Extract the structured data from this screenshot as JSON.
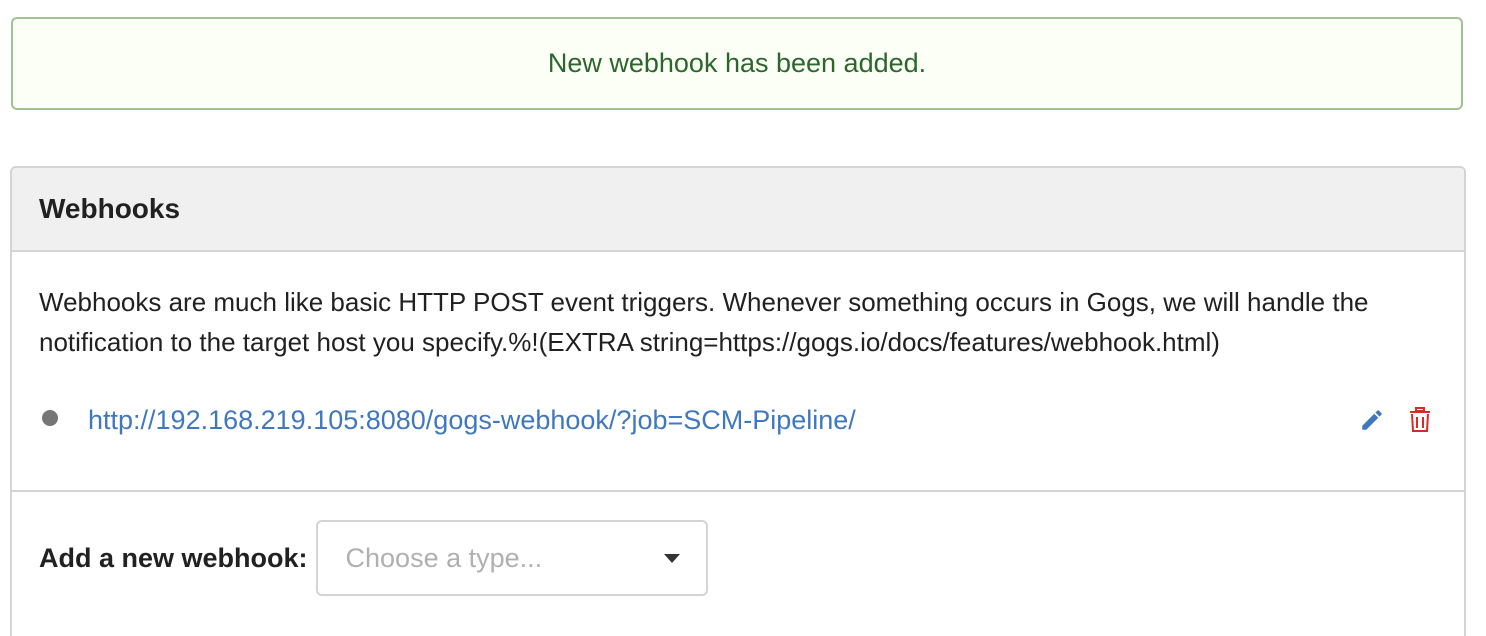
{
  "flash": {
    "message": "New webhook has been added."
  },
  "panel": {
    "title": "Webhooks",
    "description": "Webhooks are much like basic HTTP POST event triggers. Whenever something occurs in Gogs, we will handle the notification to the target host you specify.%!(EXTRA string=https://gogs.io/docs/features/webhook.html)",
    "webhooks": [
      {
        "url": "http://192.168.219.105:8080/gogs-webhook/?job=SCM-Pipeline/",
        "status_color": "#767676",
        "edit_icon": "pencil-icon",
        "delete_icon": "trash-icon"
      }
    ]
  },
  "add": {
    "label": "Add a new webhook:",
    "placeholder": "Choose a type..."
  },
  "colors": {
    "link": "#4078c0",
    "delete": "#db2828",
    "success_text": "#2c662d",
    "success_border": "#a3c293"
  }
}
